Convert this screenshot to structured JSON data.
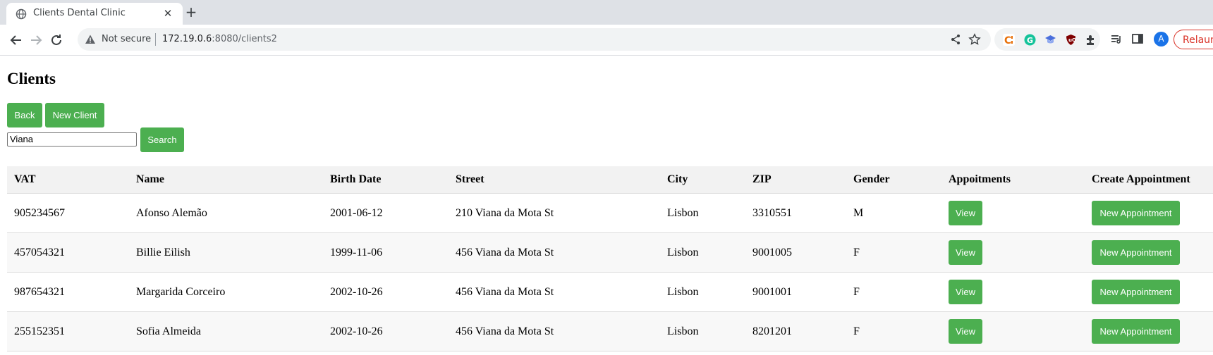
{
  "browser": {
    "tab_title": "Clients Dental Clinic",
    "security_label": "Not secure",
    "url_host": "172.19.0.6",
    "url_path": ":8080/clients2",
    "profile_initial": "A",
    "relaunch_label": "Relaunch"
  },
  "page": {
    "title": "Clients",
    "back_label": "Back",
    "new_client_label": "New Client",
    "search_value": "Viana",
    "search_label": "Search"
  },
  "table": {
    "headers": {
      "vat": "VAT",
      "name": "Name",
      "birth_date": "Birth Date",
      "street": "Street",
      "city": "City",
      "zip": "ZIP",
      "gender": "Gender",
      "appointments": "Appoitments",
      "create_appointment": "Create Appointment"
    },
    "view_label": "View",
    "new_appointment_label": "New Appointment",
    "rows": [
      {
        "vat": "905234567",
        "name": "Afonso Alemão",
        "birth_date": "2001-06-12",
        "street": "210 Viana da Mota St",
        "city": "Lisbon",
        "zip": "3310551",
        "gender": "M"
      },
      {
        "vat": "457054321",
        "name": "Billie Eilish",
        "birth_date": "1999-11-06",
        "street": "456 Viana da Mota St",
        "city": "Lisbon",
        "zip": "9001005",
        "gender": "F"
      },
      {
        "vat": "987654321",
        "name": "Margarida Corceiro",
        "birth_date": "2002-10-26",
        "street": "456 Viana da Mota St",
        "city": "Lisbon",
        "zip": "9001001",
        "gender": "F"
      },
      {
        "vat": "255152351",
        "name": "Sofia Almeida",
        "birth_date": "2002-10-26",
        "street": "456 Viana da Mota St",
        "city": "Lisbon",
        "zip": "8201201",
        "gender": "F"
      }
    ]
  },
  "colors": {
    "accent_green": "#4caf50",
    "relaunch_red": "#d93025"
  }
}
